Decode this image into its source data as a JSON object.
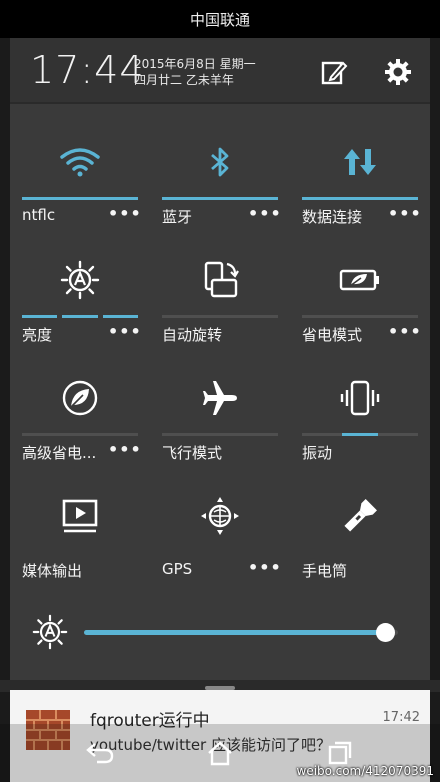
{
  "status_bar": {
    "carrier": "中国联通"
  },
  "header": {
    "time": "17:44",
    "date_line1": "2015年6月8日 星期一",
    "date_line2": "四月廿二 乙未羊年"
  },
  "tiles": [
    {
      "label": "ntflc",
      "icon": "wifi-icon",
      "more": "•••",
      "active": true
    },
    {
      "label": "蓝牙",
      "icon": "bluetooth-icon",
      "more": "•••",
      "active": true
    },
    {
      "label": "数据连接",
      "icon": "data-transfer-icon",
      "more": "•••",
      "active": true
    },
    {
      "label": "亮度",
      "icon": "auto-brightness-icon",
      "more": "•••",
      "level_segments": 3
    },
    {
      "label": "自动旋转",
      "icon": "auto-rotate-icon",
      "more": ""
    },
    {
      "label": "省电模式",
      "icon": "power-saver-icon",
      "more": "•••"
    },
    {
      "label": "高级省电...",
      "icon": "extreme-power-saver-icon",
      "more": "•••"
    },
    {
      "label": "飞行模式",
      "icon": "airplane-icon",
      "more": ""
    },
    {
      "label": "振动",
      "icon": "vibrate-icon",
      "more": "",
      "active_partial": true
    },
    {
      "label": "媒体输出",
      "icon": "media-output-icon",
      "more": ""
    },
    {
      "label": "GPS",
      "icon": "gps-icon",
      "more": "•••"
    },
    {
      "label": "手电筒",
      "icon": "flashlight-icon",
      "more": ""
    }
  ],
  "brightness": {
    "icon": "auto-brightness-icon",
    "level": 0.99
  },
  "notification": {
    "title": "fqrouter运行中",
    "time": "17:42",
    "text": "youtube/twitter 应该能访问了吧？",
    "icon": "brick-wall-icon"
  },
  "nav": {
    "back": "back-icon",
    "home": "home-icon",
    "recents": "recents-icon"
  },
  "watermark": "weibo.com/412070391",
  "colors": {
    "accent": "#5ab4d4",
    "panel": "#3a3a3a",
    "indicator_off": "#4f4f4f"
  }
}
